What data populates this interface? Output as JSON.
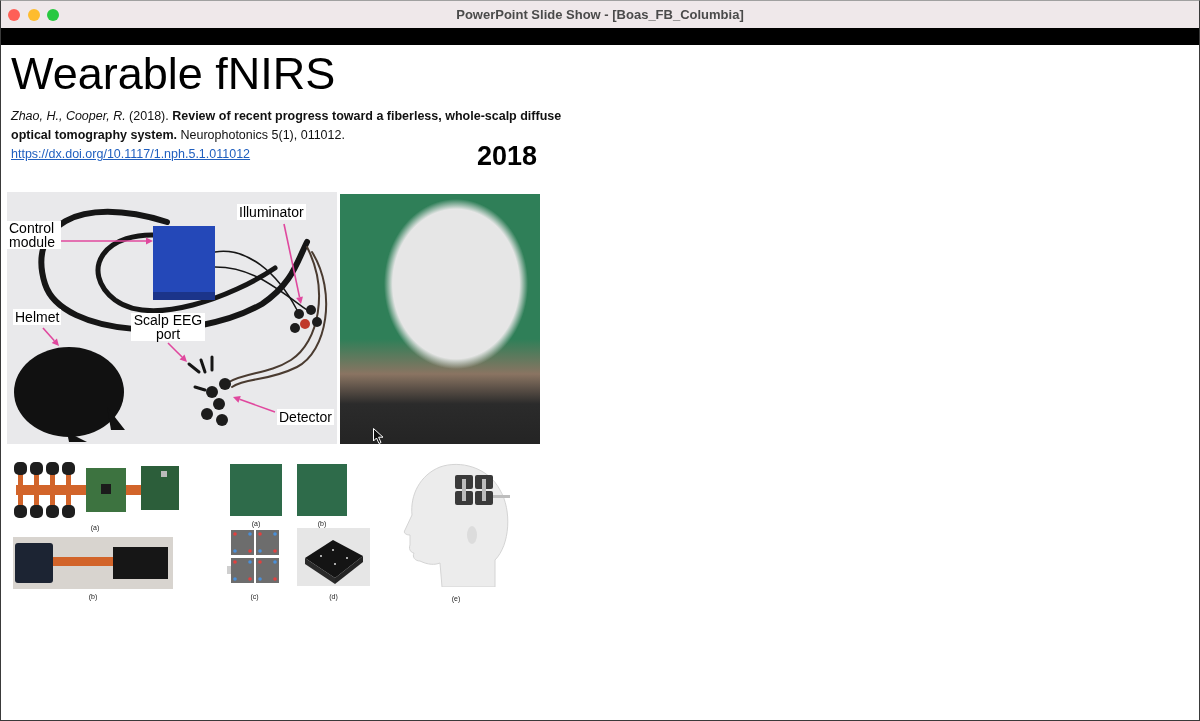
{
  "window": {
    "title": "PowerPoint Slide Show - [Boas_FB_Columbia]"
  },
  "slide": {
    "title": "Wearable fNIRS",
    "citation": "*Zhao, H., Cooper, R.* (2018). **Review of recent progress toward a fiberless, whole-scalp diffuse optical tomography system.** Neurophotonics 5(1), 011012.",
    "link": "https://dx.doi.org/10.1117/1.nph.5.1.011012",
    "year": "2018",
    "device_photo": {
      "labels": [
        {
          "text": "Illuminator"
        },
        {
          "text": "Control module"
        },
        {
          "text": "Helmet"
        },
        {
          "text": "Scalp EEG port"
        },
        {
          "text": "Detector"
        }
      ]
    },
    "figure_groups": [
      {
        "panels": [
          {
            "kind": "board",
            "caption": "(a)"
          },
          {
            "kind": "array",
            "caption": "(b)"
          }
        ]
      },
      {
        "panels": [
          {
            "kind": "pcb",
            "caption": "(a)"
          },
          {
            "kind": "pcb",
            "caption": "(b)"
          },
          {
            "kind": "layout",
            "caption": "(c)"
          },
          {
            "kind": "modules",
            "caption": "(d)"
          }
        ]
      },
      {
        "panels": [
          {
            "kind": "head",
            "caption": "(e)"
          }
        ]
      }
    ]
  }
}
